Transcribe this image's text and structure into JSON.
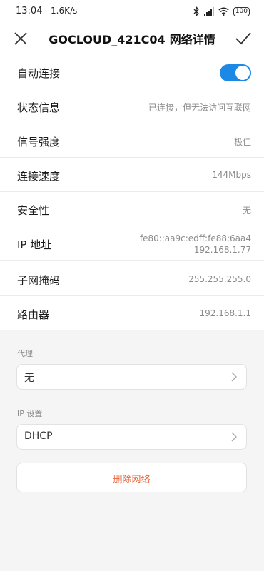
{
  "status_bar": {
    "time": "13:04",
    "speed": "1.6K/s",
    "battery": "100"
  },
  "header": {
    "title": "GOCLOUD_421C04",
    "subtitle": "网络详情"
  },
  "details": {
    "auto_connect": {
      "label": "自动连接",
      "enabled": true
    },
    "rows": [
      {
        "label": "状态信息",
        "value": "已连接，但无法访问互联网"
      },
      {
        "label": "信号强度",
        "value": "极佳"
      },
      {
        "label": "连接速度",
        "value": "144Mbps"
      },
      {
        "label": "安全性",
        "value": "无"
      },
      {
        "label": "IP 地址",
        "value": "fe80::aa9c:edff:fe88:6aa4",
        "value2": "192.168.1.77"
      },
      {
        "label": "子网掩码",
        "value": "255.255.255.0"
      },
      {
        "label": "路由器",
        "value": "192.168.1.1"
      }
    ]
  },
  "proxy": {
    "label": "代理",
    "value": "无"
  },
  "ip_settings": {
    "label": "IP 设置",
    "value": "DHCP"
  },
  "delete_label": "删除网络",
  "colors": {
    "accent": "#1e88e5",
    "danger": "#e8643a"
  }
}
